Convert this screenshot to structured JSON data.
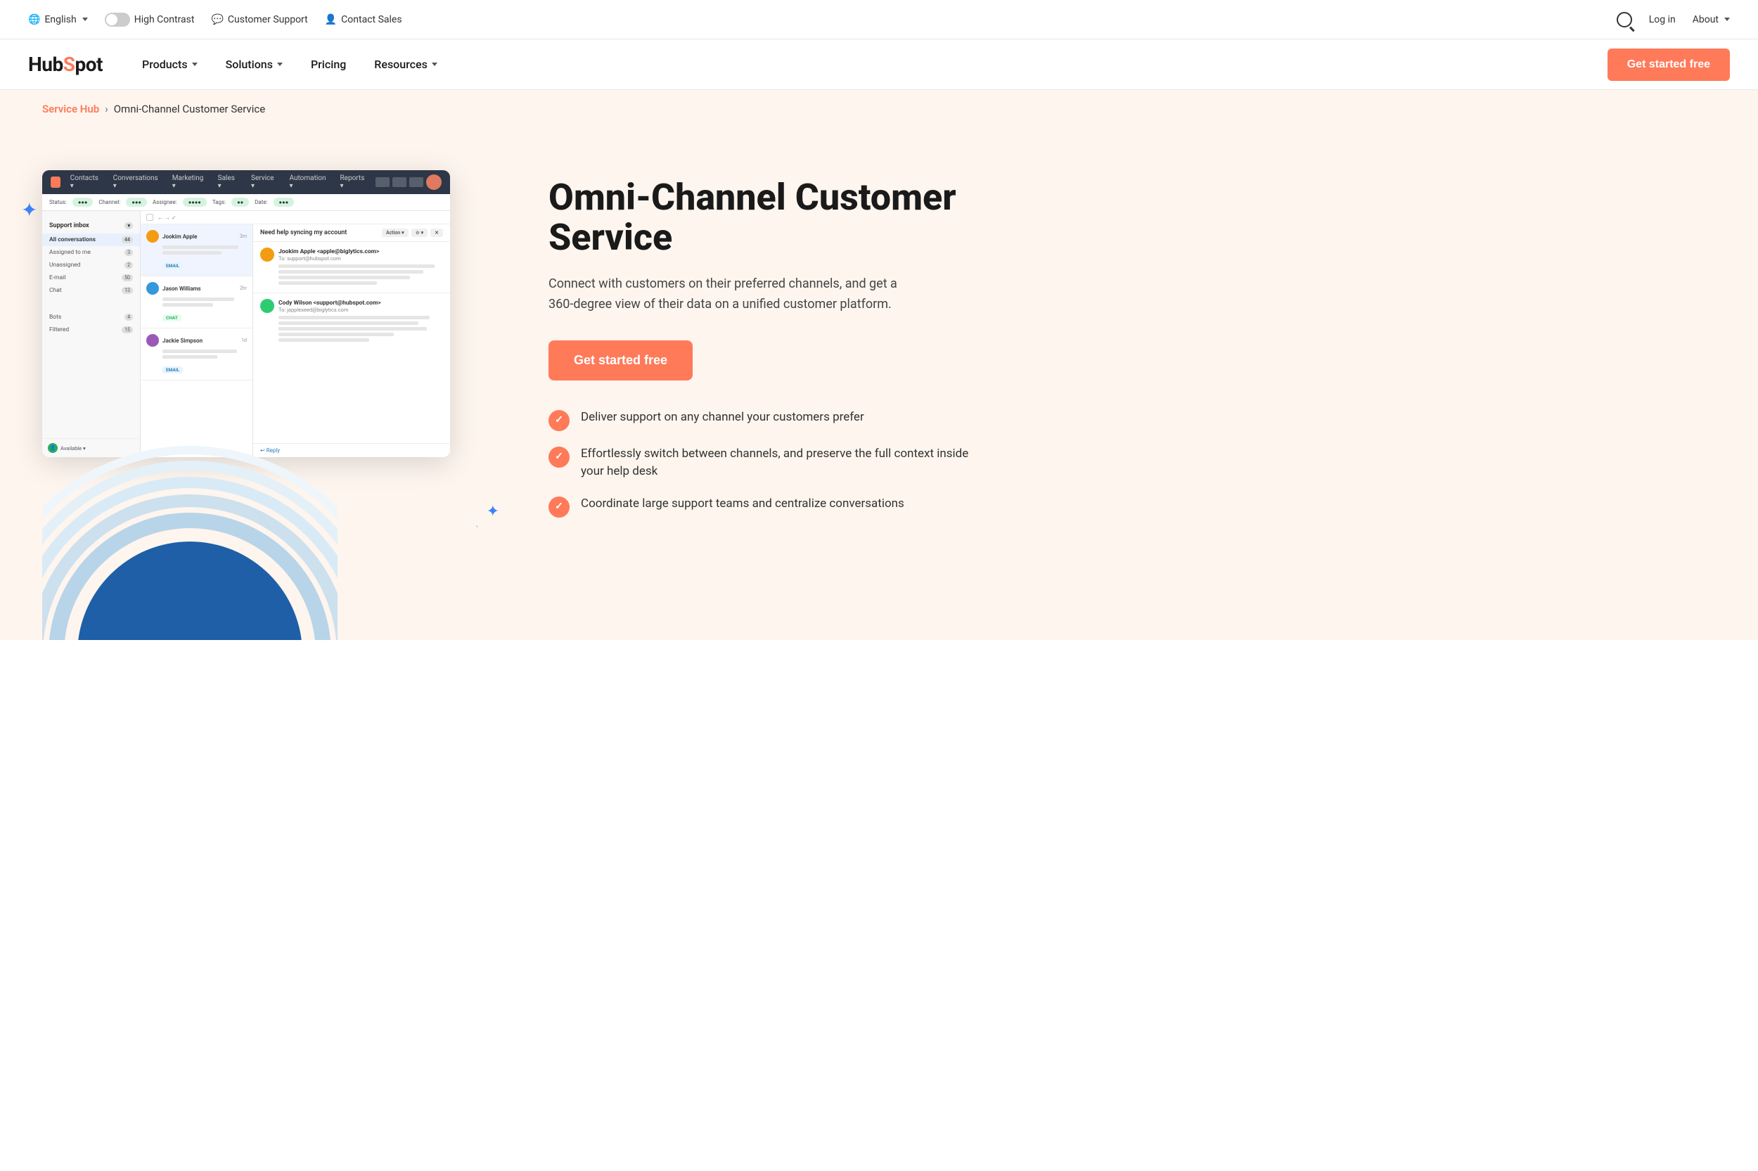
{
  "topbar": {
    "language_label": "English",
    "high_contrast_label": "High Contrast",
    "customer_support_label": "Customer Support",
    "contact_sales_label": "Contact Sales",
    "login_label": "Log in",
    "about_label": "About"
  },
  "navbar": {
    "logo_hub": "Hub",
    "logo_spot": "Spot",
    "products_label": "Products",
    "solutions_label": "Solutions",
    "pricing_label": "Pricing",
    "resources_label": "Resources",
    "get_started_label": "Get started free"
  },
  "breadcrumb": {
    "parent_label": "Service Hub",
    "separator": "›",
    "current_label": "Omni-Channel Customer Service"
  },
  "hero": {
    "title": "Omni-Channel Customer Service",
    "description": "Connect with customers on their preferred channels, and get a 360-degree view of their data on a unified customer platform.",
    "cta_label": "Get started free",
    "features": [
      {
        "text": "Deliver support on any channel your customers prefer"
      },
      {
        "text": "Effortlessly switch between channels, and preserve the full context inside your help desk"
      },
      {
        "text": "Coordinate large support teams and centralize conversations"
      }
    ]
  },
  "mockup": {
    "nav_items": [
      "Contacts",
      "Conversations",
      "Marketing",
      "Sales",
      "Service",
      "Automation",
      "Reports"
    ],
    "sidebar_title": "Support inbox",
    "sidebar_items": [
      {
        "label": "All conversations",
        "count": "44"
      },
      {
        "label": "Assigned to me",
        "count": "3"
      },
      {
        "label": "Unassigned",
        "count": "2"
      },
      {
        "label": "E-mail",
        "count": "50"
      },
      {
        "label": "Chat",
        "count": "13"
      },
      {
        "label": "Bots",
        "count": "4"
      },
      {
        "label": "Filtered",
        "count": "15"
      }
    ],
    "conversations": [
      {
        "name": "Jookim Apple",
        "time": "3m",
        "tag": "EMAIL",
        "tag_type": "email"
      },
      {
        "name": "Jason Williams",
        "time": "2hr",
        "tag": "CHAT",
        "tag_type": "chat"
      },
      {
        "name": "Jackie Simpson",
        "time": "1d",
        "tag": "EMAIL",
        "tag_type": "email"
      }
    ],
    "detail_subject": "Need help syncing my account",
    "detail_sender_name": "Jookim Apple",
    "detail_sender_email": "apple@biglytics.com",
    "detail_to": "To: support@hubspot.com",
    "second_sender_name": "Cody Wilson",
    "second_sender_email": "<support@hubspot.com>",
    "second_to": "To: jappleseed@biglytics.com",
    "reply_label": "Reply",
    "status_label": "Available",
    "filter_labels": [
      "Status:",
      "Channel:",
      "Assignee:",
      "Tags:",
      "Date:"
    ]
  },
  "colors": {
    "orange": "#ff7a59",
    "dark_navy": "#2d3748",
    "bg_cream": "#fdf5ee",
    "blue_sparkle": "#3b82f6"
  }
}
